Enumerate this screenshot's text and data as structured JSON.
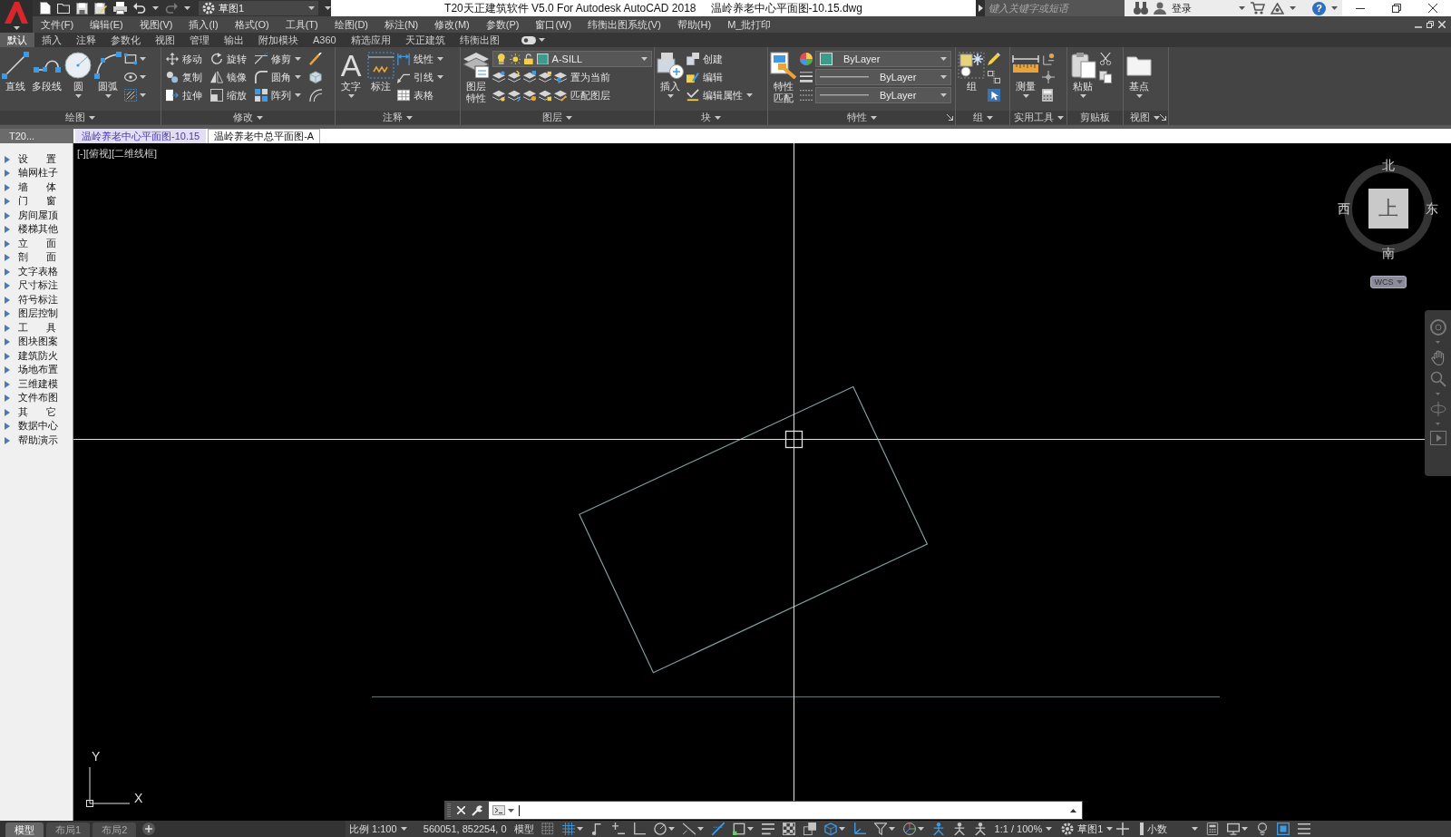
{
  "title_bar": {
    "workspace": "草图1",
    "title": "T20天正建筑软件 V5.0 For Autodesk AutoCAD 2018",
    "file_name": "温岭养老中心平面图-10.15.dwg",
    "search": {
      "placeholder": "键入关键字或短语"
    },
    "sign_in": "登录",
    "help": "?"
  },
  "menu_bar": [
    "文件(F)",
    "编辑(E)",
    "视图(V)",
    "插入(I)",
    "格式(O)",
    "工具(T)",
    "绘图(D)",
    "标注(N)",
    "修改(M)",
    "参数(P)",
    "窗口(W)",
    "纬衡出图系统(V)",
    "帮助(H)",
    "M_批打印"
  ],
  "ribbon_tabs": [
    {
      "label": "默认",
      "selected": true
    },
    {
      "label": "插入",
      "selected": false
    },
    {
      "label": "注释",
      "selected": false
    },
    {
      "label": "参数化",
      "selected": false
    },
    {
      "label": "视图",
      "selected": false
    },
    {
      "label": "管理",
      "selected": false
    },
    {
      "label": "输出",
      "selected": false
    },
    {
      "label": "附加模块",
      "selected": false
    },
    {
      "label": "A360",
      "selected": false
    },
    {
      "label": "精选应用",
      "selected": false
    },
    {
      "label": "天正建筑",
      "selected": false
    },
    {
      "label": "纬衡出图",
      "selected": false
    }
  ],
  "ribbon_panels": [
    {
      "title": "绘图",
      "expandable": true,
      "launcher": false,
      "columns": [
        [
          {
            "kind": "large",
            "label": "直线"
          }
        ],
        [
          {
            "kind": "large",
            "label": "多段线"
          }
        ],
        [
          {
            "kind": "large_split",
            "label": "圆"
          }
        ],
        [
          {
            "kind": "large_split",
            "label": "圆弧"
          }
        ]
      ]
    },
    {
      "title": "修改",
      "expandable": true,
      "launcher": false,
      "columns": [
        [
          {
            "kind": "small",
            "label": "移动"
          },
          {
            "kind": "small",
            "label": "复制"
          },
          {
            "kind": "small",
            "label": "拉伸"
          }
        ],
        [
          {
            "kind": "small",
            "label": "旋转"
          },
          {
            "kind": "small",
            "label": "镜像"
          },
          {
            "kind": "small",
            "label": "缩放"
          }
        ],
        [
          {
            "kind": "small_split",
            "label": "修剪"
          },
          {
            "kind": "small_split",
            "label": "圆角"
          },
          {
            "kind": "small_split",
            "label": "阵列"
          }
        ]
      ]
    },
    {
      "title": "注释",
      "expandable": true,
      "launcher": false,
      "columns": [
        [
          {
            "kind": "large_split",
            "label": "文字",
            "glyph": "A"
          }
        ],
        [
          {
            "kind": "large",
            "label": "标注"
          }
        ],
        [
          {
            "kind": "small_split",
            "label": "线性"
          },
          {
            "kind": "small_split",
            "label": "引线"
          },
          {
            "kind": "small",
            "label": "表格"
          }
        ]
      ]
    },
    {
      "title": "图层",
      "expandable": true,
      "launcher": false,
      "columns": [
        [
          {
            "kind": "large_wrap",
            "label": "图层特性"
          }
        ],
        [
          {
            "kind": "layer_combo",
            "value": "A-SILL"
          },
          {
            "kind": "small",
            "label": "置为当前"
          },
          {
            "kind": "small",
            "label": "匹配图层"
          }
        ]
      ]
    },
    {
      "title": "块",
      "expandable": true,
      "launcher": false,
      "columns": [
        [
          {
            "kind": "large_split",
            "label": "插入"
          }
        ],
        [
          {
            "kind": "small",
            "label": "创建"
          },
          {
            "kind": "small",
            "label": "编辑"
          },
          {
            "kind": "small_split",
            "label": "编辑属性"
          }
        ]
      ]
    },
    {
      "title": "特性",
      "expandable": true,
      "launcher": true,
      "columns": [
        [
          {
            "kind": "large_wrap",
            "label": "特性匹配"
          }
        ],
        [
          {
            "kind": "color_combo",
            "value": "ByLayer"
          },
          {
            "kind": "line_combo",
            "value": "ByLayer"
          },
          {
            "kind": "line_combo",
            "value": "ByLayer"
          }
        ]
      ]
    },
    {
      "title": "组",
      "expandable": true,
      "launcher": false,
      "columns": [
        [
          {
            "kind": "large",
            "label": "组"
          }
        ]
      ]
    },
    {
      "title": "实用工具",
      "expandable": true,
      "launcher": false,
      "columns": [
        [
          {
            "kind": "large_split",
            "label": "测量"
          }
        ]
      ]
    },
    {
      "title": "剪贴板",
      "expandable": false,
      "launcher": false,
      "columns": [
        [
          {
            "kind": "large_split",
            "label": "粘贴"
          }
        ]
      ]
    },
    {
      "title": "视图",
      "expandable": true,
      "launcher": true,
      "columns": [
        [
          {
            "kind": "large_split",
            "label": "基点"
          }
        ]
      ]
    }
  ],
  "document_tabs": {
    "palette_title": "T20...",
    "tabs": [
      {
        "label": "温岭养老中心平面图-10.15",
        "selected": true
      },
      {
        "label": "温岭养老中总平面图-A",
        "selected": false
      }
    ]
  },
  "sidebar": {
    "items": [
      "设 置",
      "轴网柱子",
      "墙 体",
      "门 窗",
      "房间屋顶",
      "楼梯其他",
      "立 面",
      "剖 面",
      "文字表格",
      "尺寸标注",
      "符号标注",
      "图层控制",
      "工 具",
      "图块图案",
      "建筑防火",
      "场地布置",
      "三维建模",
      "文件布图",
      "其 它",
      "数据中心",
      "帮助演示"
    ]
  },
  "viewport": {
    "label": "[-][俯视][二维线框]",
    "view_cube": {
      "north": "北",
      "south": "南",
      "west": "西",
      "east": "东",
      "face": "上",
      "coordinate_system": "WCS"
    },
    "ucs": {
      "x": "X",
      "y": "Y"
    }
  },
  "status_bar": {
    "layout_tabs": [
      {
        "label": "模型",
        "selected": true
      },
      {
        "label": "布局1",
        "selected": false
      },
      {
        "label": "布局2",
        "selected": false
      }
    ],
    "scale": "比例 1:100",
    "coordinates": "560051, 852254, 0",
    "space": "模型",
    "drafting_toggles": [
      {
        "on": false
      },
      {
        "on": true
      },
      {
        "on": false
      },
      {
        "on": false
      },
      {
        "on": false
      },
      {
        "on": false
      },
      {
        "on": false
      },
      {
        "on": true
      },
      {
        "on": false
      },
      {
        "on": false
      },
      {
        "on": false
      },
      {
        "on": false
      },
      {
        "on": true
      },
      {
        "on": true
      },
      {
        "on": false
      },
      {
        "on": false
      },
      {
        "on": true
      },
      {
        "on": false
      },
      {
        "on": false
      }
    ],
    "annotation_scale": "1:1 / 100%",
    "workspace": "草图1",
    "units": "小数",
    "tool_toggles": [
      {
        "on": false
      },
      {
        "on": false
      },
      {
        "on": false
      },
      {
        "on": true
      },
      {
        "on": false
      }
    ]
  }
}
